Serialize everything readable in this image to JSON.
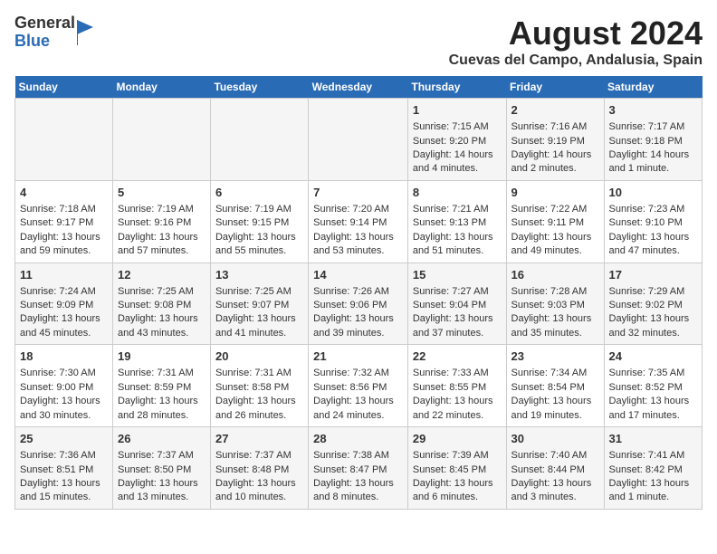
{
  "logo": {
    "general": "General",
    "blue": "Blue"
  },
  "title": "August 2024",
  "subtitle": "Cuevas del Campo, Andalusia, Spain",
  "days_of_week": [
    "Sunday",
    "Monday",
    "Tuesday",
    "Wednesday",
    "Thursday",
    "Friday",
    "Saturday"
  ],
  "weeks": [
    [
      {
        "day": "",
        "content": ""
      },
      {
        "day": "",
        "content": ""
      },
      {
        "day": "",
        "content": ""
      },
      {
        "day": "",
        "content": ""
      },
      {
        "day": "1",
        "content": "Sunrise: 7:15 AM\nSunset: 9:20 PM\nDaylight: 14 hours\nand 4 minutes."
      },
      {
        "day": "2",
        "content": "Sunrise: 7:16 AM\nSunset: 9:19 PM\nDaylight: 14 hours\nand 2 minutes."
      },
      {
        "day": "3",
        "content": "Sunrise: 7:17 AM\nSunset: 9:18 PM\nDaylight: 14 hours\nand 1 minute."
      }
    ],
    [
      {
        "day": "4",
        "content": "Sunrise: 7:18 AM\nSunset: 9:17 PM\nDaylight: 13 hours\nand 59 minutes."
      },
      {
        "day": "5",
        "content": "Sunrise: 7:19 AM\nSunset: 9:16 PM\nDaylight: 13 hours\nand 57 minutes."
      },
      {
        "day": "6",
        "content": "Sunrise: 7:19 AM\nSunset: 9:15 PM\nDaylight: 13 hours\nand 55 minutes."
      },
      {
        "day": "7",
        "content": "Sunrise: 7:20 AM\nSunset: 9:14 PM\nDaylight: 13 hours\nand 53 minutes."
      },
      {
        "day": "8",
        "content": "Sunrise: 7:21 AM\nSunset: 9:13 PM\nDaylight: 13 hours\nand 51 minutes."
      },
      {
        "day": "9",
        "content": "Sunrise: 7:22 AM\nSunset: 9:11 PM\nDaylight: 13 hours\nand 49 minutes."
      },
      {
        "day": "10",
        "content": "Sunrise: 7:23 AM\nSunset: 9:10 PM\nDaylight: 13 hours\nand 47 minutes."
      }
    ],
    [
      {
        "day": "11",
        "content": "Sunrise: 7:24 AM\nSunset: 9:09 PM\nDaylight: 13 hours\nand 45 minutes."
      },
      {
        "day": "12",
        "content": "Sunrise: 7:25 AM\nSunset: 9:08 PM\nDaylight: 13 hours\nand 43 minutes."
      },
      {
        "day": "13",
        "content": "Sunrise: 7:25 AM\nSunset: 9:07 PM\nDaylight: 13 hours\nand 41 minutes."
      },
      {
        "day": "14",
        "content": "Sunrise: 7:26 AM\nSunset: 9:06 PM\nDaylight: 13 hours\nand 39 minutes."
      },
      {
        "day": "15",
        "content": "Sunrise: 7:27 AM\nSunset: 9:04 PM\nDaylight: 13 hours\nand 37 minutes."
      },
      {
        "day": "16",
        "content": "Sunrise: 7:28 AM\nSunset: 9:03 PM\nDaylight: 13 hours\nand 35 minutes."
      },
      {
        "day": "17",
        "content": "Sunrise: 7:29 AM\nSunset: 9:02 PM\nDaylight: 13 hours\nand 32 minutes."
      }
    ],
    [
      {
        "day": "18",
        "content": "Sunrise: 7:30 AM\nSunset: 9:00 PM\nDaylight: 13 hours\nand 30 minutes."
      },
      {
        "day": "19",
        "content": "Sunrise: 7:31 AM\nSunset: 8:59 PM\nDaylight: 13 hours\nand 28 minutes."
      },
      {
        "day": "20",
        "content": "Sunrise: 7:31 AM\nSunset: 8:58 PM\nDaylight: 13 hours\nand 26 minutes."
      },
      {
        "day": "21",
        "content": "Sunrise: 7:32 AM\nSunset: 8:56 PM\nDaylight: 13 hours\nand 24 minutes."
      },
      {
        "day": "22",
        "content": "Sunrise: 7:33 AM\nSunset: 8:55 PM\nDaylight: 13 hours\nand 22 minutes."
      },
      {
        "day": "23",
        "content": "Sunrise: 7:34 AM\nSunset: 8:54 PM\nDaylight: 13 hours\nand 19 minutes."
      },
      {
        "day": "24",
        "content": "Sunrise: 7:35 AM\nSunset: 8:52 PM\nDaylight: 13 hours\nand 17 minutes."
      }
    ],
    [
      {
        "day": "25",
        "content": "Sunrise: 7:36 AM\nSunset: 8:51 PM\nDaylight: 13 hours\nand 15 minutes."
      },
      {
        "day": "26",
        "content": "Sunrise: 7:37 AM\nSunset: 8:50 PM\nDaylight: 13 hours\nand 13 minutes."
      },
      {
        "day": "27",
        "content": "Sunrise: 7:37 AM\nSunset: 8:48 PM\nDaylight: 13 hours\nand 10 minutes."
      },
      {
        "day": "28",
        "content": "Sunrise: 7:38 AM\nSunset: 8:47 PM\nDaylight: 13 hours\nand 8 minutes."
      },
      {
        "day": "29",
        "content": "Sunrise: 7:39 AM\nSunset: 8:45 PM\nDaylight: 13 hours\nand 6 minutes."
      },
      {
        "day": "30",
        "content": "Sunrise: 7:40 AM\nSunset: 8:44 PM\nDaylight: 13 hours\nand 3 minutes."
      },
      {
        "day": "31",
        "content": "Sunrise: 7:41 AM\nSunset: 8:42 PM\nDaylight: 13 hours\nand 1 minute."
      }
    ]
  ]
}
